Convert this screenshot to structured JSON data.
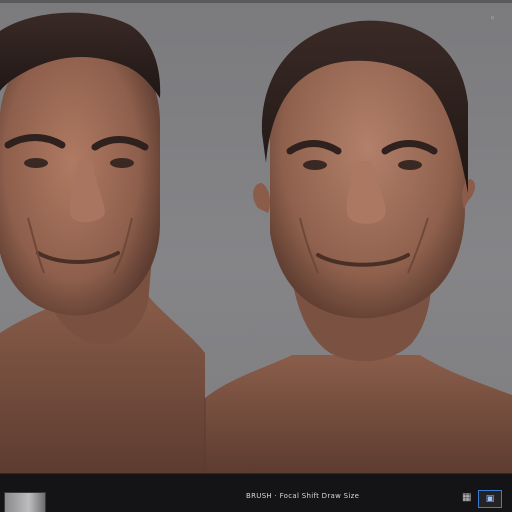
{
  "app": {
    "title": "",
    "viewport": {
      "background": "#808083",
      "left_model": {
        "name": "",
        "skin_color": "#9b6a57",
        "hair_color": "#2a1f1d"
      },
      "right_model": {
        "name": "",
        "skin_color": "#9a6a56",
        "hair_color": "#2a1f1d"
      },
      "corner_icon": "cursor-icon"
    },
    "status_bar": {
      "left_label": "",
      "mid_label": "BRUSH · Focal Shift Draw Size",
      "thumb_icon": "material-preview-icon",
      "right_icon": "grid-icon",
      "right_button_icon": "dock-icon",
      "accent": "#3c7bd2"
    }
  }
}
